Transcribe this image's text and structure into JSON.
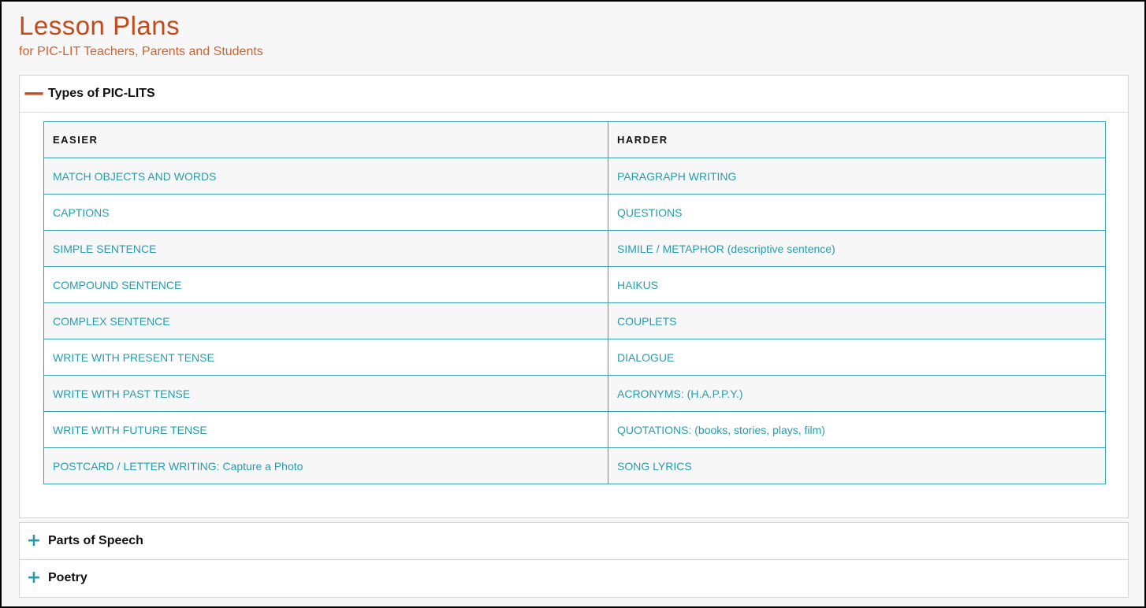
{
  "page": {
    "title": "Lesson Plans",
    "subtitle": "for PIC-LIT Teachers, Parents and Students"
  },
  "accordion": [
    {
      "title": "Types of PIC-LITS",
      "expanded": true,
      "icon": "minus-icon"
    },
    {
      "title": "Parts of Speech",
      "expanded": false,
      "icon": "plus-icon"
    },
    {
      "title": "Poetry",
      "expanded": false,
      "icon": "plus-icon"
    }
  ],
  "table": {
    "headers": [
      "EASIER",
      "HARDER"
    ],
    "rows": [
      [
        "MATCH OBJECTS AND WORDS",
        "PARAGRAPH WRITING"
      ],
      [
        "CAPTIONS",
        "QUESTIONS"
      ],
      [
        "SIMPLE SENTENCE",
        "SIMILE / METAPHOR (descriptive sentence)"
      ],
      [
        "COMPOUND SENTENCE",
        "HAIKUS"
      ],
      [
        "COMPLEX SENTENCE",
        "COUPLETS"
      ],
      [
        "WRITE WITH PRESENT TENSE",
        "DIALOGUE"
      ],
      [
        "WRITE WITH PAST TENSE",
        "ACRONYMS: (H.A.P.P.Y.)"
      ],
      [
        "WRITE WITH FUTURE TENSE",
        "QUOTATIONS: (books, stories, plays, film)"
      ],
      [
        "POSTCARD / LETTER WRITING: Capture a Photo",
        "SONG LYRICS"
      ]
    ]
  },
  "colors": {
    "title": "#c24a1b",
    "subtitle": "#d0622d",
    "link": "#2a9bad",
    "table_border": "#3aa1b4",
    "minus_icon": "#c24a1b",
    "plus_icon": "#2a9bad"
  }
}
